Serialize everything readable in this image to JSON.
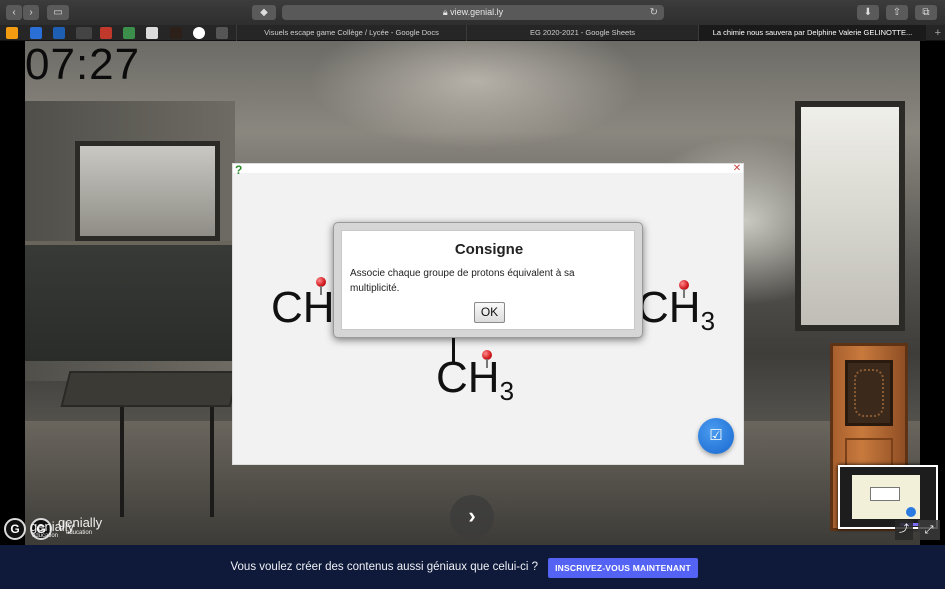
{
  "browser": {
    "url": "view.genial.ly",
    "tabs": [
      {
        "label": "Visuels escape game Collège / Lycée - Google Docs"
      },
      {
        "label": "EG 2020-2021 - Google Sheets"
      },
      {
        "label": "La chimie nous sauvera par Delphine Valerie GELINOTTE..."
      }
    ],
    "new_tab": "+"
  },
  "timer": "07:27",
  "molecule": {
    "left_group": "CH",
    "right_group": "CH",
    "right_sub": "3",
    "bottom_group": "CH",
    "bottom_sub": "3"
  },
  "dialog": {
    "title": "Consigne",
    "message": "Associe chaque groupe de protons équivalent à sa multiplicité.",
    "ok_label": "OK"
  },
  "branding": {
    "logo_letter": "G",
    "name": "genially",
    "sub": "education"
  },
  "footer": {
    "text": "Vous voulez créer des contenus aussi géniaux que celui-ci ?",
    "cta_label": "INSCRIVEZ-VOUS MAINTENANT"
  },
  "colors": {
    "footer_bg": "#0f1a3a",
    "cta_bg": "#5563f5",
    "check_button": "#1767cf",
    "pin": "#d0161b"
  }
}
